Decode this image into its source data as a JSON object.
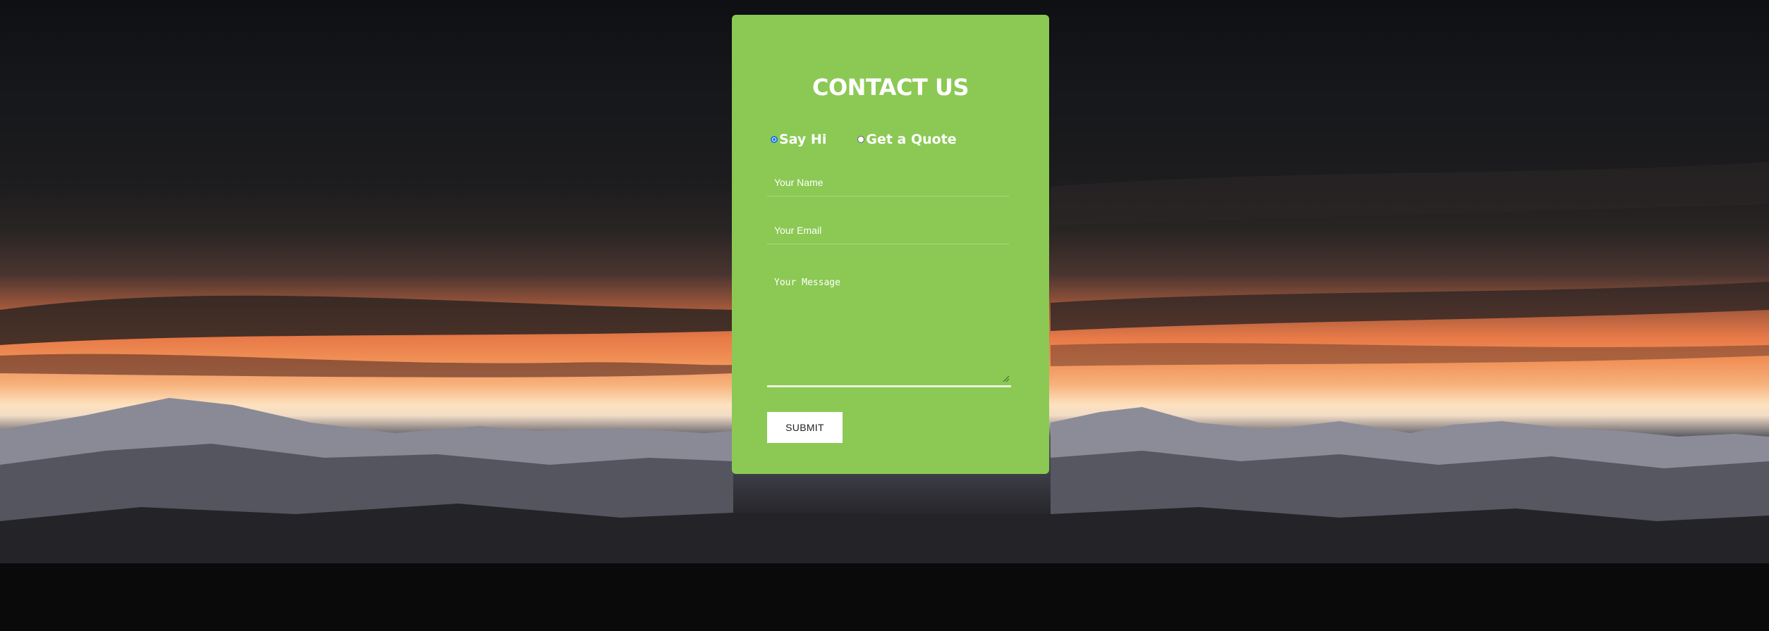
{
  "form": {
    "title": "CONTACT US",
    "radio_options": [
      {
        "label": "Say Hi",
        "checked": true
      },
      {
        "label": "Get a Quote",
        "checked": false
      }
    ],
    "name_placeholder": "Your Name",
    "email_placeholder": "Your Email",
    "message_placeholder": "Your Message",
    "submit_label": "SUBMIT"
  },
  "colors": {
    "card_background": "#8bc954",
    "text": "#ffffff",
    "radio_accent": "#1a73e8"
  }
}
